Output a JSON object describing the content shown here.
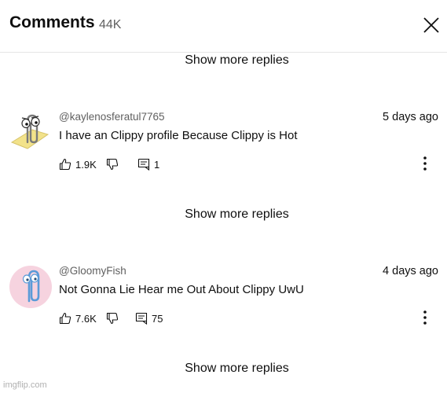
{
  "header": {
    "title": "Comments",
    "count": "44K"
  },
  "show_more_label": "Show more replies",
  "comments": [
    {
      "handle": "@kaylenosferatul7765",
      "time": "5 days ago",
      "text": "I have an Clippy profile Because Clippy is Hot",
      "likes": "1.9K",
      "replies": "1"
    },
    {
      "handle": "@GloomyFish",
      "time": "4 days ago",
      "text": "Not Gonna Lie Hear me Out About Clippy UwU",
      "likes": "7.6K",
      "replies": "75"
    }
  ],
  "watermark": "imgflip.com",
  "colors": {
    "secondary_text": "#606060",
    "divider": "#e5e5e5",
    "avatar2_bg": "#f6d3df"
  }
}
